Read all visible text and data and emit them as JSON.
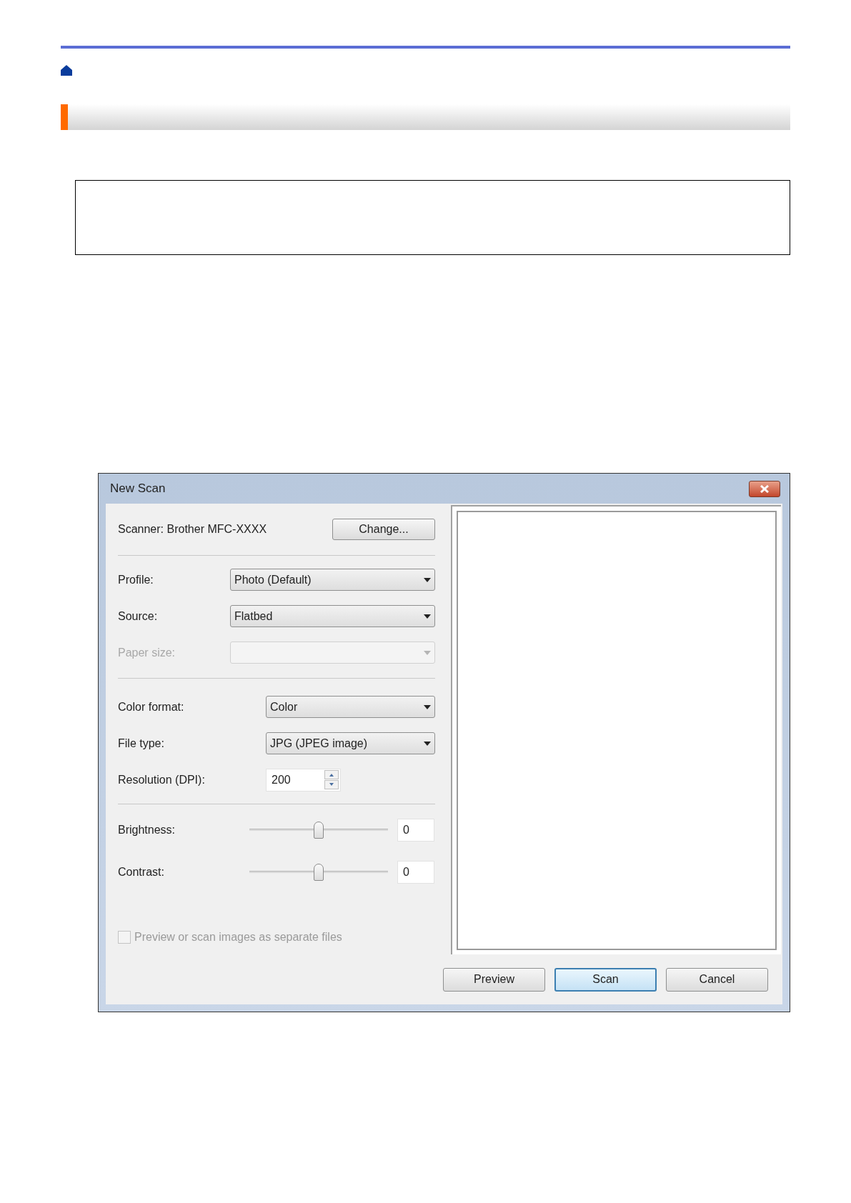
{
  "dialog": {
    "title": "New Scan",
    "scanner": {
      "label": "Scanner: Brother MFC-XXXX",
      "button": "Change..."
    },
    "device_fields": [
      {
        "label": "Profile:",
        "value": "Photo (Default)",
        "disabled": false
      },
      {
        "label": "Source:",
        "value": "Flatbed",
        "disabled": false
      },
      {
        "label": "Paper size:",
        "disabled": true
      }
    ],
    "format_fields": [
      {
        "kind": "dropdown",
        "label": "Color format:",
        "value": "Color"
      },
      {
        "kind": "dropdown",
        "label": "File type:",
        "value": "JPG (JPEG image)"
      },
      {
        "kind": "spin",
        "label": "Resolution (DPI):",
        "value": "200"
      }
    ],
    "sliders": [
      {
        "label": "Brightness:",
        "level": 0.5,
        "value": "0"
      },
      {
        "label": "Contrast:",
        "level": 0.5,
        "value": "0"
      }
    ],
    "option": {
      "label": "Preview or scan images as separate files",
      "checked": false,
      "disabled": true
    },
    "buttons": [
      {
        "label": "Preview",
        "selected": false
      },
      {
        "label": "Scan",
        "selected": true
      },
      {
        "label": "Cancel",
        "selected": false
      }
    ]
  }
}
